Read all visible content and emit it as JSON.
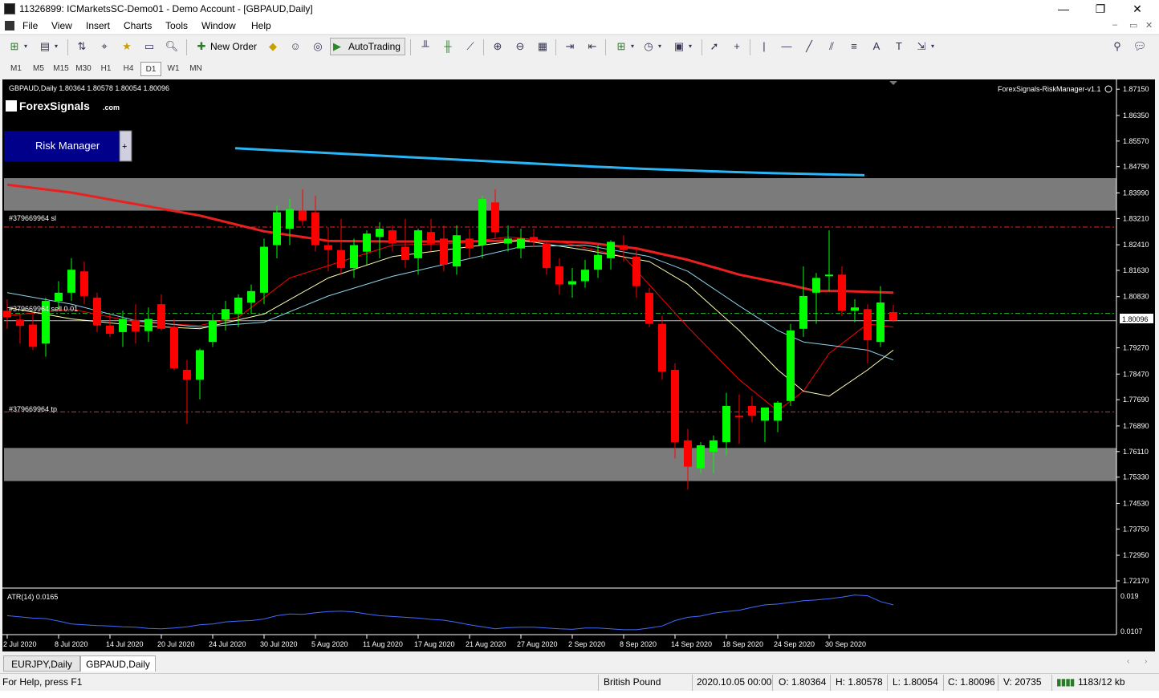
{
  "window": {
    "title": "11326899: ICMarketsSC-Demo01 - Demo Account - [GBPAUD,Daily]",
    "controls": {
      "minimize": "—",
      "maximize": "❐",
      "close": "✕"
    }
  },
  "menu": [
    "File",
    "View",
    "Insert",
    "Charts",
    "Tools",
    "Window",
    "Help"
  ],
  "toolbar": {
    "new_order": "New Order",
    "autotrading": "AutoTrading"
  },
  "periods": [
    "M1",
    "M5",
    "M15",
    "M30",
    "H1",
    "H4",
    "D1",
    "W1",
    "MN"
  ],
  "active_period": "D1",
  "chart": {
    "header": "GBPAUD,Daily  1.80364 1.80578 1.80054 1.80096",
    "indicator_name": "ForexSignals-RiskManager-v1.1",
    "brand": "ForexSignals",
    "brand_suffix": ".com",
    "risk_manager_label": "Risk Manager",
    "risk_manager_plus": "+",
    "sl_label": "#379669964 sl",
    "order_label": "#379669964 sell 0.01",
    "tp_label": "#379669964 tp",
    "current_price": "1.80096",
    "atr_label": "ATR(14) 0.0165",
    "atr_levels": [
      "0.019",
      "0.0107"
    ],
    "colors": {
      "bull": "#00ff00",
      "bear": "#ff0000",
      "ma_slow": "#29b6f6",
      "ma_mid": "#e82020",
      "ma_fast": "#ffffb0",
      "ma_light": "#8ed4e8",
      "zone": "#7b7b7b",
      "atr": "#3f6cff"
    }
  },
  "chart_data": {
    "type": "candlestick",
    "symbol": "GBPAUD",
    "timeframe": "Daily",
    "y_ticks": [
      1.8715,
      1.8635,
      1.8557,
      1.8479,
      1.8399,
      1.8321,
      1.8241,
      1.8163,
      1.8083,
      1.7927,
      1.7847,
      1.7769,
      1.7689,
      1.7611,
      1.7533,
      1.7453,
      1.7375,
      1.7295,
      1.7217
    ],
    "x_labels": [
      "2 Jul 2020",
      "8 Jul 2020",
      "14 Jul 2020",
      "20 Jul 2020",
      "24 Jul 2020",
      "30 Jul 2020",
      "5 Aug 2020",
      "11 Aug 2020",
      "17 Aug 2020",
      "21 Aug 2020",
      "27 Aug 2020",
      "2 Sep 2020",
      "8 Sep 2020",
      "14 Sep 2020",
      "18 Sep 2020",
      "24 Sep 2020",
      "30 Sep 2020"
    ],
    "ylim": [
      1.7195,
      1.8735
    ],
    "zones": [
      [
        1.8345,
        1.8444
      ],
      [
        1.7521,
        1.7622
      ]
    ],
    "levels": {
      "sl": 1.8295,
      "entry": 1.8032,
      "current": 1.80096,
      "tp": 1.7732
    },
    "candles": [
      {
        "o": 1.804,
        "h": 1.8075,
        "l": 1.7985,
        "c": 1.802
      },
      {
        "o": 1.8013,
        "h": 1.803,
        "l": 1.794,
        "c": 1.7994
      },
      {
        "o": 1.7998,
        "h": 1.8028,
        "l": 1.792,
        "c": 1.793
      },
      {
        "o": 1.794,
        "h": 1.808,
        "l": 1.79,
        "c": 1.807
      },
      {
        "o": 1.807,
        "h": 1.813,
        "l": 1.8045,
        "c": 1.8095
      },
      {
        "o": 1.8095,
        "h": 1.82,
        "l": 1.807,
        "c": 1.8165
      },
      {
        "o": 1.816,
        "h": 1.819,
        "l": 1.806,
        "c": 1.8085
      },
      {
        "o": 1.808,
        "h": 1.8095,
        "l": 1.7975,
        "c": 1.7995
      },
      {
        "o": 1.7995,
        "h": 1.803,
        "l": 1.796,
        "c": 1.797
      },
      {
        "o": 1.7975,
        "h": 1.804,
        "l": 1.793,
        "c": 1.8015
      },
      {
        "o": 1.8012,
        "h": 1.806,
        "l": 1.794,
        "c": 1.7977
      },
      {
        "o": 1.7978,
        "h": 1.805,
        "l": 1.7945,
        "c": 1.8015
      },
      {
        "o": 1.806,
        "h": 1.809,
        "l": 1.798,
        "c": 1.7985
      },
      {
        "o": 1.799,
        "h": 1.8015,
        "l": 1.786,
        "c": 1.7865
      },
      {
        "o": 1.786,
        "h": 1.789,
        "l": 1.7695,
        "c": 1.783
      },
      {
        "o": 1.783,
        "h": 1.7925,
        "l": 1.777,
        "c": 1.792
      },
      {
        "o": 1.7945,
        "h": 1.803,
        "l": 1.793,
        "c": 1.801
      },
      {
        "o": 1.8013,
        "h": 1.807,
        "l": 1.798,
        "c": 1.8045
      },
      {
        "o": 1.803,
        "h": 1.809,
        "l": 1.799,
        "c": 1.808
      },
      {
        "o": 1.8065,
        "h": 1.812,
        "l": 1.803,
        "c": 1.81
      },
      {
        "o": 1.8095,
        "h": 1.826,
        "l": 1.806,
        "c": 1.8235
      },
      {
        "o": 1.824,
        "h": 1.836,
        "l": 1.82,
        "c": 1.834
      },
      {
        "o": 1.829,
        "h": 1.838,
        "l": 1.824,
        "c": 1.835
      },
      {
        "o": 1.8345,
        "h": 1.841,
        "l": 1.83,
        "c": 1.8315
      },
      {
        "o": 1.834,
        "h": 1.839,
        "l": 1.822,
        "c": 1.824
      },
      {
        "o": 1.824,
        "h": 1.8295,
        "l": 1.816,
        "c": 1.8225
      },
      {
        "o": 1.8225,
        "h": 1.832,
        "l": 1.815,
        "c": 1.817
      },
      {
        "o": 1.817,
        "h": 1.826,
        "l": 1.814,
        "c": 1.824
      },
      {
        "o": 1.822,
        "h": 1.8285,
        "l": 1.818,
        "c": 1.8275
      },
      {
        "o": 1.8265,
        "h": 1.831,
        "l": 1.82,
        "c": 1.829
      },
      {
        "o": 1.8285,
        "h": 1.83,
        "l": 1.822,
        "c": 1.8245
      },
      {
        "o": 1.8235,
        "h": 1.832,
        "l": 1.817,
        "c": 1.8195
      },
      {
        "o": 1.82,
        "h": 1.829,
        "l": 1.815,
        "c": 1.8285
      },
      {
        "o": 1.828,
        "h": 1.832,
        "l": 1.822,
        "c": 1.8245
      },
      {
        "o": 1.826,
        "h": 1.83,
        "l": 1.816,
        "c": 1.818
      },
      {
        "o": 1.8175,
        "h": 1.83,
        "l": 1.815,
        "c": 1.827
      },
      {
        "o": 1.826,
        "h": 1.829,
        "l": 1.82,
        "c": 1.823
      },
      {
        "o": 1.824,
        "h": 1.839,
        "l": 1.82,
        "c": 1.838
      },
      {
        "o": 1.837,
        "h": 1.841,
        "l": 1.826,
        "c": 1.828
      },
      {
        "o": 1.8245,
        "h": 1.83,
        "l": 1.822,
        "c": 1.826
      },
      {
        "o": 1.823,
        "h": 1.829,
        "l": 1.82,
        "c": 1.826
      },
      {
        "o": 1.8265,
        "h": 1.829,
        "l": 1.8235,
        "c": 1.825
      },
      {
        "o": 1.8245,
        "h": 1.825,
        "l": 1.815,
        "c": 1.817
      },
      {
        "o": 1.8175,
        "h": 1.82,
        "l": 1.809,
        "c": 1.812
      },
      {
        "o": 1.812,
        "h": 1.817,
        "l": 1.808,
        "c": 1.813
      },
      {
        "o": 1.813,
        "h": 1.8195,
        "l": 1.811,
        "c": 1.8165
      },
      {
        "o": 1.8165,
        "h": 1.824,
        "l": 1.814,
        "c": 1.821
      },
      {
        "o": 1.82,
        "h": 1.8255,
        "l": 1.8165,
        "c": 1.825
      },
      {
        "o": 1.824,
        "h": 1.827,
        "l": 1.819,
        "c": 1.8225
      },
      {
        "o": 1.8205,
        "h": 1.823,
        "l": 1.808,
        "c": 1.8115
      },
      {
        "o": 1.8095,
        "h": 1.811,
        "l": 1.799,
        "c": 1.8
      },
      {
        "o": 1.8,
        "h": 1.8025,
        "l": 1.783,
        "c": 1.7855
      },
      {
        "o": 1.786,
        "h": 1.788,
        "l": 1.759,
        "c": 1.764
      },
      {
        "o": 1.7645,
        "h": 1.768,
        "l": 1.7495,
        "c": 1.7565
      },
      {
        "o": 1.756,
        "h": 1.764,
        "l": 1.7545,
        "c": 1.763
      },
      {
        "o": 1.761,
        "h": 1.766,
        "l": 1.7545,
        "c": 1.7645
      },
      {
        "o": 1.764,
        "h": 1.779,
        "l": 1.76,
        "c": 1.775
      },
      {
        "o": 1.772,
        "h": 1.7785,
        "l": 1.7635,
        "c": 1.7715
      },
      {
        "o": 1.775,
        "h": 1.778,
        "l": 1.77,
        "c": 1.772
      },
      {
        "o": 1.7705,
        "h": 1.774,
        "l": 1.764,
        "c": 1.7745
      },
      {
        "o": 1.7705,
        "h": 1.7765,
        "l": 1.767,
        "c": 1.776
      },
      {
        "o": 1.7765,
        "h": 1.8,
        "l": 1.775,
        "c": 1.798
      },
      {
        "o": 1.7985,
        "h": 1.8175,
        "l": 1.796,
        "c": 1.8085
      },
      {
        "o": 1.8095,
        "h": 1.8155,
        "l": 1.8,
        "c": 1.814
      },
      {
        "o": 1.8145,
        "h": 1.8285,
        "l": 1.81,
        "c": 1.815
      },
      {
        "o": 1.815,
        "h": 1.8175,
        "l": 1.8025,
        "c": 1.804
      },
      {
        "o": 1.804,
        "h": 1.8075,
        "l": 1.8005,
        "c": 1.805
      },
      {
        "o": 1.8045,
        "h": 1.806,
        "l": 1.788,
        "c": 1.795
      },
      {
        "o": 1.7945,
        "h": 1.8115,
        "l": 1.793,
        "c": 1.8065
      },
      {
        "o": 1.8036,
        "h": 1.8058,
        "l": 1.8005,
        "c": 1.801
      }
    ],
    "series": [
      {
        "type": "line",
        "values": [
          [
            0,
            1.8535
          ],
          [
            1,
            1.8528
          ],
          [
            2,
            1.8521
          ],
          [
            3,
            1.8514
          ],
          [
            4,
            1.8507
          ],
          [
            5,
            1.85
          ],
          [
            6,
            1.8493
          ],
          [
            7,
            1.8486
          ],
          [
            8,
            1.8479
          ],
          [
            9,
            1.8473
          ],
          [
            10,
            1.8468
          ],
          [
            11,
            1.8463
          ],
          [
            12,
            1.8459
          ],
          [
            13,
            1.8456
          ],
          [
            14,
            1.8453
          ]
        ]
      },
      {
        "type": "line",
        "values": [
          [
            0,
            1.8424
          ],
          [
            5,
            1.84
          ],
          [
            10,
            1.8365
          ],
          [
            15,
            1.833
          ],
          [
            20,
            1.8282
          ],
          [
            25,
            1.8253
          ],
          [
            30,
            1.8251
          ],
          [
            35,
            1.8251
          ],
          [
            40,
            1.8254
          ],
          [
            45,
            1.8248
          ],
          [
            49,
            1.823
          ],
          [
            53,
            1.8195
          ],
          [
            57,
            1.815
          ],
          [
            61,
            1.8118
          ],
          [
            63,
            1.81
          ],
          [
            65,
            1.81
          ],
          [
            69,
            1.8095
          ]
        ]
      },
      {
        "type": "line",
        "values": [
          [
            0,
            1.8025
          ],
          [
            5,
            1.8045
          ],
          [
            10,
            1.8005
          ],
          [
            15,
            1.7995
          ],
          [
            18,
            1.802
          ],
          [
            22,
            1.814
          ],
          [
            26,
            1.819
          ],
          [
            30,
            1.824
          ],
          [
            35,
            1.8245
          ],
          [
            39,
            1.8265
          ],
          [
            43,
            1.825
          ],
          [
            48,
            1.8205
          ],
          [
            53,
            1.799
          ],
          [
            57,
            1.783
          ],
          [
            60,
            1.7735
          ],
          [
            62,
            1.7795
          ],
          [
            64,
            1.791
          ],
          [
            67,
            1.8
          ],
          [
            69,
            1.799
          ]
        ]
      },
      {
        "type": "line",
        "values": [
          [
            0,
            1.805
          ],
          [
            5,
            1.8015
          ],
          [
            10,
            1.7995
          ],
          [
            15,
            1.7985
          ],
          [
            20,
            1.803
          ],
          [
            25,
            1.814
          ],
          [
            30,
            1.8205
          ],
          [
            35,
            1.823
          ],
          [
            40,
            1.8255
          ],
          [
            45,
            1.8225
          ],
          [
            50,
            1.819
          ],
          [
            53,
            1.812
          ],
          [
            57,
            1.798
          ],
          [
            60,
            1.786
          ],
          [
            62,
            1.7795
          ],
          [
            64,
            1.778
          ],
          [
            67,
            1.786
          ],
          [
            69,
            1.792
          ]
        ]
      },
      {
        "type": "line",
        "values": [
          [
            0,
            1.8095
          ],
          [
            5,
            1.806
          ],
          [
            10,
            1.801
          ],
          [
            15,
            1.799
          ],
          [
            20,
            1.8005
          ],
          [
            25,
            1.8085
          ],
          [
            30,
            1.8145
          ],
          [
            35,
            1.819
          ],
          [
            40,
            1.8235
          ],
          [
            45,
            1.824
          ],
          [
            50,
            1.8205
          ],
          [
            53,
            1.816
          ],
          [
            57,
            1.8055
          ],
          [
            60,
            1.798
          ],
          [
            62,
            1.7945
          ],
          [
            64,
            1.7935
          ],
          [
            67,
            1.792
          ],
          [
            69,
            1.789
          ]
        ]
      }
    ],
    "atr_ylim": [
      0.0098,
      0.0195
    ],
    "atr_values": [
      0.014,
      0.0137,
      0.0134,
      0.0133,
      0.0127,
      0.012,
      0.0118,
      0.0116,
      0.0115,
      0.0113,
      0.0112,
      0.0109,
      0.0108,
      0.011,
      0.0113,
      0.0118,
      0.012,
      0.0125,
      0.0127,
      0.0128,
      0.0132,
      0.014,
      0.0144,
      0.0143,
      0.0147,
      0.015,
      0.0151,
      0.0149,
      0.0144,
      0.014,
      0.0138,
      0.0136,
      0.0134,
      0.0131,
      0.0129,
      0.0124,
      0.0118,
      0.0113,
      0.0108,
      0.0111,
      0.0112,
      0.0112,
      0.011,
      0.0108,
      0.0107,
      0.011,
      0.011,
      0.0108,
      0.0106,
      0.0106,
      0.011,
      0.0115,
      0.0128,
      0.0136,
      0.0139,
      0.0146,
      0.015,
      0.0153,
      0.016,
      0.0166,
      0.0168,
      0.0172,
      0.0176,
      0.0178,
      0.0181,
      0.0185,
      0.019,
      0.0188,
      0.0174,
      0.0166
    ]
  },
  "tabs": [
    "EURJPY,Daily",
    "GBPAUD,Daily"
  ],
  "active_tab": "GBPAUD,Daily",
  "status": {
    "help": "For Help, press F1",
    "profile": "British Pound",
    "datetime": "2020.10.05 00:00",
    "open": "O: 1.80364",
    "high": "H: 1.80578",
    "low": "L: 1.80054",
    "close": "C: 1.80096",
    "volume": "V: 20735",
    "traffic": "1183/12 kb"
  }
}
